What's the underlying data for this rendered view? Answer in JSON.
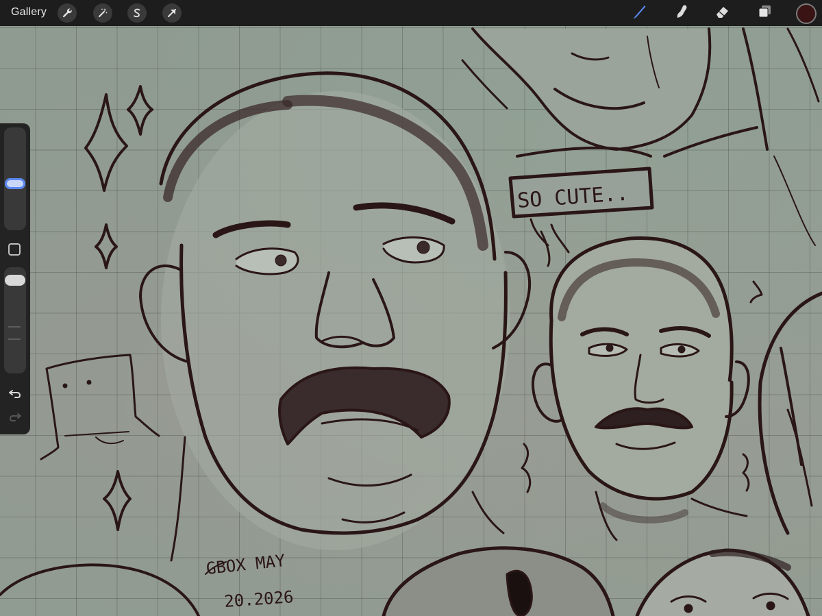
{
  "toolbar": {
    "gallery_label": "Gallery",
    "left_tools": [
      {
        "name": "actions",
        "icon": "wrench-icon"
      },
      {
        "name": "adjustments",
        "icon": "magic-wand-icon"
      },
      {
        "name": "selection",
        "icon": "selection-s-icon"
      },
      {
        "name": "transform",
        "icon": "arrow-cursor-icon"
      }
    ],
    "right_tools": [
      {
        "name": "brush",
        "icon": "brush-icon",
        "active": true
      },
      {
        "name": "smudge",
        "icon": "smudge-icon",
        "active": false
      },
      {
        "name": "eraser",
        "icon": "eraser-icon",
        "active": false
      },
      {
        "name": "layers",
        "icon": "layers-icon",
        "active": false
      }
    ],
    "current_color": "#3a1414",
    "active_tool_color": "#5a87f0"
  },
  "sidebar": {
    "brush_size_level": 0.6,
    "opacity_level": 0.95,
    "controls": [
      "size-slider",
      "modify-button",
      "opacity-slider",
      "undo-button",
      "redo-button"
    ]
  },
  "canvas": {
    "background": "#8f9b91",
    "grid": true,
    "handwritten_text": [
      "SO CUTE..",
      "GBOX MAY",
      "20.2026"
    ]
  }
}
